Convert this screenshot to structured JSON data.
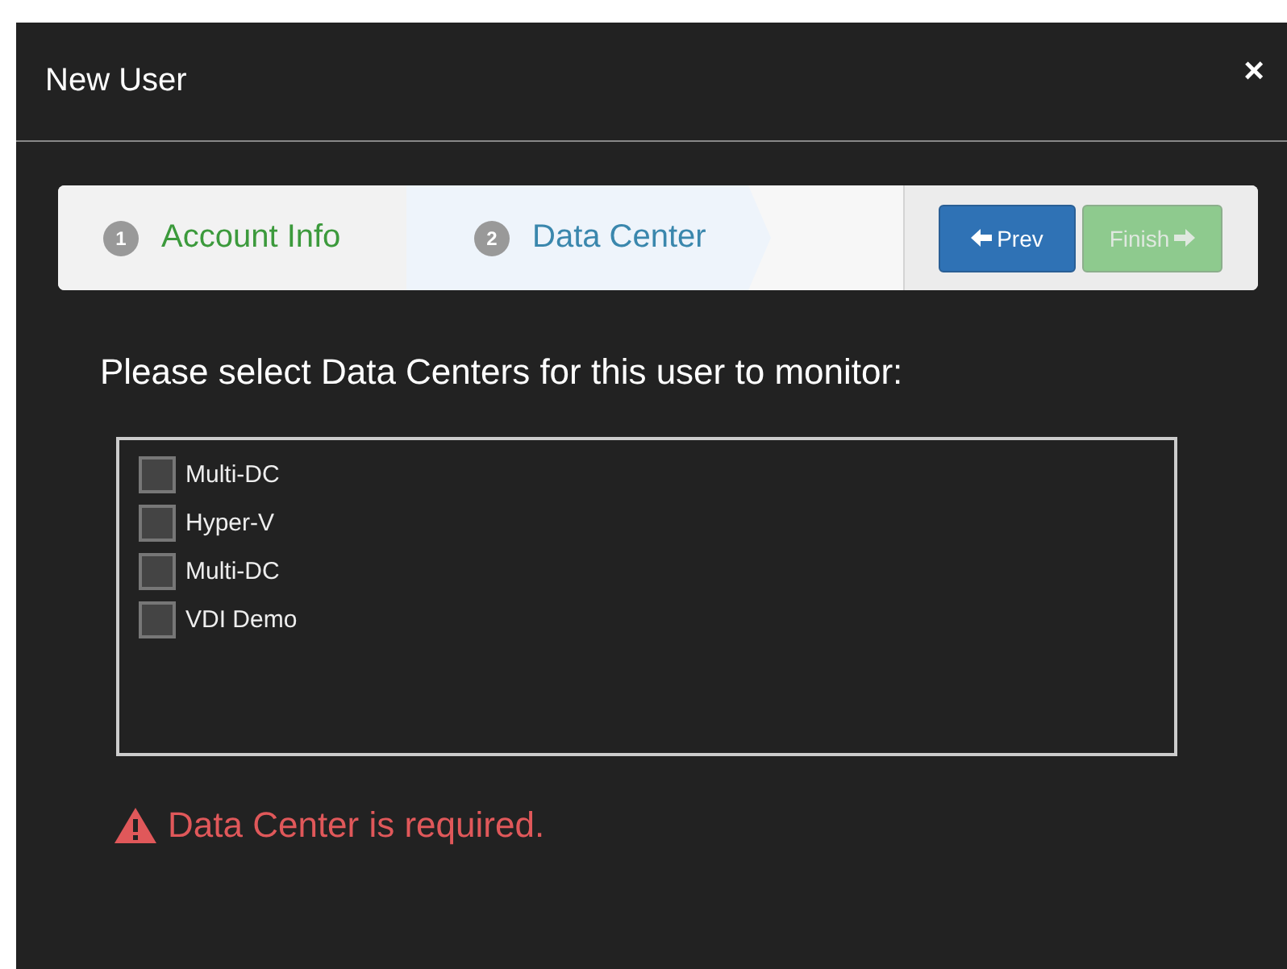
{
  "dialog": {
    "title": "New User",
    "close": "×"
  },
  "steps": [
    {
      "number": "1",
      "label": "Account Info",
      "selected": false,
      "complete": true
    },
    {
      "number": "2",
      "label": "Data Center",
      "selected": true,
      "complete": false
    }
  ],
  "buttons": [
    {
      "label": "Prev",
      "kind": "back",
      "disabled": false
    },
    {
      "label": "Finish",
      "kind": "next",
      "disabled": true
    }
  ],
  "prompt": "Please select Data Centers for this user to monitor:",
  "data_centers": [
    {
      "label": "Multi-DC",
      "checked": false
    },
    {
      "label": "Hyper-V",
      "checked": false
    },
    {
      "label": "Multi-DC",
      "checked": false
    },
    {
      "label": "VDI Demo",
      "checked": false
    }
  ],
  "error": "Data Center is required."
}
